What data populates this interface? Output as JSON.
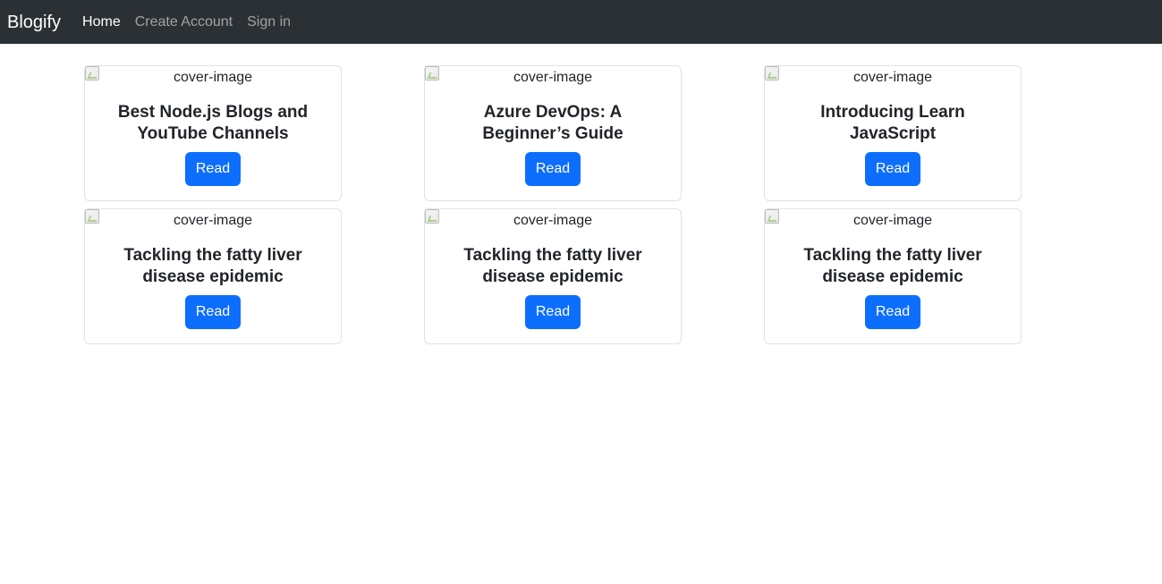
{
  "navbar": {
    "brand": "Blogify",
    "links": [
      {
        "label": "Home",
        "active": true
      },
      {
        "label": "Create Account",
        "active": false
      },
      {
        "label": "Sign in",
        "active": false
      }
    ]
  },
  "cards": [
    {
      "image_alt": "cover-image",
      "title": "Best Node.js Blogs and YouTube Channels",
      "button": "Read"
    },
    {
      "image_alt": "cover-image",
      "title": "Azure DevOps: A Beginner’s Guide",
      "button": "Read"
    },
    {
      "image_alt": "cover-image",
      "title": "Introducing Learn JavaScript",
      "button": "Read"
    },
    {
      "image_alt": "cover-image",
      "title": "Tackling the fatty liver disease epidemic",
      "button": "Read"
    },
    {
      "image_alt": "cover-image",
      "title": "Tackling the fatty liver disease epidemic",
      "button": "Read"
    },
    {
      "image_alt": "cover-image",
      "title": "Tackling the fatty liver disease epidemic",
      "button": "Read"
    }
  ],
  "colors": {
    "navbar_bg": "#2b3035",
    "button_primary": "#0d6efd",
    "card_border": "#dfe2e6"
  },
  "icons": {
    "cover": "broken-image-icon"
  }
}
